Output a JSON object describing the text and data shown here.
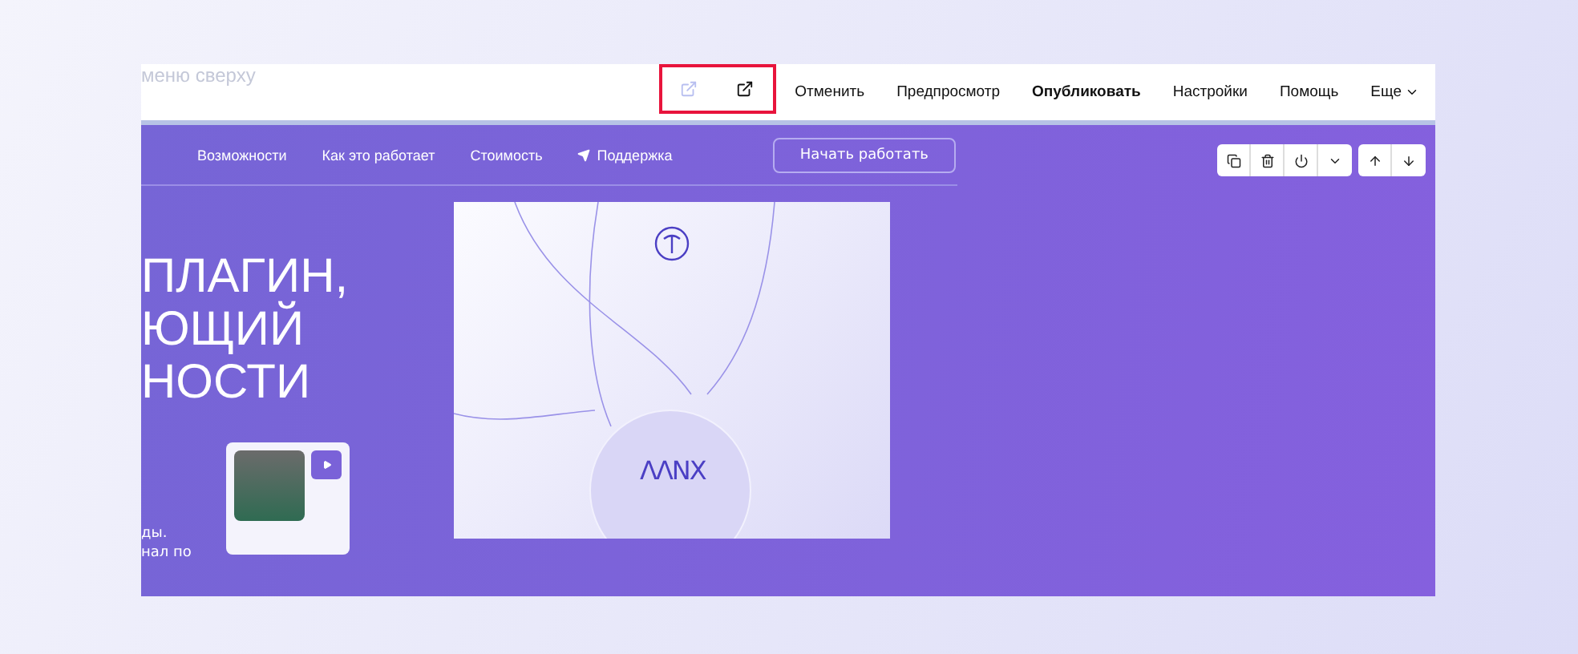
{
  "editor_bar": {
    "hint": "меню сверху",
    "icons": [
      {
        "kind": "open-link",
        "disabled": true
      },
      {
        "kind": "open-link",
        "disabled": false
      }
    ],
    "actions": [
      {
        "label": "Отменить",
        "primary": false,
        "dropdown": false
      },
      {
        "label": "Предпросмотр",
        "primary": false,
        "dropdown": false
      },
      {
        "label": "Опубликовать",
        "primary": true,
        "dropdown": false
      },
      {
        "label": "Настройки",
        "primary": false,
        "dropdown": false
      },
      {
        "label": "Помощь",
        "primary": false,
        "dropdown": false
      },
      {
        "label": "Еще",
        "primary": false,
        "dropdown": true
      }
    ]
  },
  "nav": {
    "links": [
      {
        "label": "Возможности",
        "icon": false
      },
      {
        "label": "Как это работает",
        "icon": false
      },
      {
        "label": "Стоимость",
        "icon": false
      },
      {
        "label": "Поддержка",
        "icon": true
      }
    ],
    "cta": "Начать работать"
  },
  "block_tools": [
    [
      {
        "kind": "copy"
      },
      {
        "kind": "delete"
      },
      {
        "kind": "power"
      },
      {
        "kind": "caret"
      }
    ],
    [
      {
        "kind": "up"
      },
      {
        "kind": "down"
      }
    ]
  ],
  "hero": {
    "headline": [
      "ПЛАГИН,",
      "ЮЩИЙ",
      "НОСТИ"
    ],
    "body": [
      "ды.",
      "нал по"
    ],
    "logo": "ΛΛΝX"
  }
}
